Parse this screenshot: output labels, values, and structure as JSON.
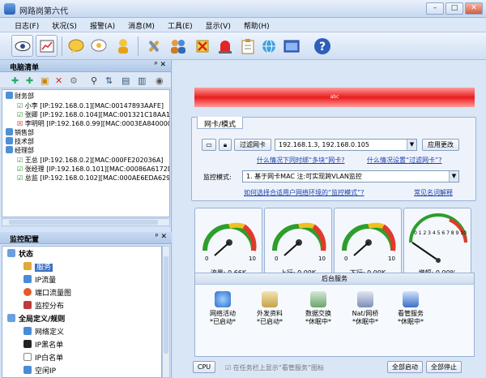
{
  "window": {
    "title": "网路岗第六代"
  },
  "menu": [
    "日志(F)",
    "状况(S)",
    "报警(A)",
    "消息(M)",
    "工具(E)",
    "显示(V)",
    "帮助(H)"
  ],
  "left_panel": {
    "title": "电脑清单",
    "tree": [
      {
        "label": "财务部",
        "kind": "group"
      },
      {
        "label": "小李 [IP:192.168.0.1][MAC:00147893AAFE]",
        "kind": "pc",
        "status": "ok"
      },
      {
        "label": "张卿 [IP:192.168.0.104][MAC:001321C18AA1]",
        "kind": "pc",
        "status": "ok"
      },
      {
        "label": "李明明 [IP:192.168.0.99][MAC:0003EA840000",
        "kind": "pc",
        "status": "no"
      },
      {
        "label": "销售部",
        "kind": "group"
      },
      {
        "label": "技术部",
        "kind": "group"
      },
      {
        "label": "经理部",
        "kind": "group"
      },
      {
        "label": "王总 [IP:192.168.0.2][MAC:000FE202036A]",
        "kind": "pc",
        "status": "ok"
      },
      {
        "label": "张经理 [IP:192.168.0.101][MAC:00086A6172D",
        "kind": "pc",
        "status": "ok"
      },
      {
        "label": "总监 [IP:192.168.0.102][MAC:000AE6EDA629]",
        "kind": "pc",
        "status": "ok"
      }
    ]
  },
  "config_panel": {
    "title": "监控配置",
    "items": [
      {
        "label": "状态",
        "level": 0
      },
      {
        "label": "服务",
        "level": 1,
        "selected": true
      },
      {
        "label": "IP流量",
        "level": 1
      },
      {
        "label": "端口流量图",
        "level": 1
      },
      {
        "label": "监控分布",
        "level": 1
      },
      {
        "label": "全局定义/规则",
        "level": 0
      },
      {
        "label": "网络定义",
        "level": 1
      },
      {
        "label": "IP黑名单",
        "level": 1
      },
      {
        "label": "IP白名单",
        "level": 1
      },
      {
        "label": "空闲IP",
        "level": 1
      }
    ]
  },
  "main": {
    "banner_text": "abc",
    "card": {
      "tab": "网卡/模式",
      "filter_button": "过滤网卡",
      "nic_value": "192.168.1.3, 192.168.0.105",
      "apply_button": "应用更改",
      "link_multi": "什么情况下同时绑“多块”网卡?",
      "link_filter": "什么情况设置“过滤网卡”?",
      "mode_label": "监控模式:",
      "mode_value": "1. 基于网卡MAC  注:可实现跨VLAN监控",
      "link_mode": "如何选择合适用户网络环境的“监控模式”?",
      "link_faq": "常见名词解释"
    },
    "gauges": [
      {
        "label": "流量: 0.66K",
        "value": 0.066,
        "max": 10,
        "type": "rainbow"
      },
      {
        "label": "上行: 0.00K",
        "value": 0.0,
        "max": 10,
        "type": "rainbow"
      },
      {
        "label": "下行: 0.00K",
        "value": 0.0,
        "max": 10,
        "type": "rainbow"
      },
      {
        "label": "增幅: 0.00%",
        "value": 0.0,
        "max": 10,
        "type": "arc"
      }
    ],
    "services": {
      "title": "后台服务",
      "items": [
        {
          "name": "网络活动",
          "status": "*已启动*"
        },
        {
          "name": "外发资料",
          "status": "*已启动*"
        },
        {
          "name": "数据交换",
          "status": "*休眠中*"
        },
        {
          "name": "Nat/网桥",
          "status": "*休眠中*"
        },
        {
          "name": "看管服务",
          "status": "*休眠中*"
        }
      ]
    },
    "bottom": {
      "cpu_button": "CPU",
      "tray_checkbox": "在任务栏上显示“看管服务”图标",
      "start_all": "全部启动",
      "stop_all": "全部停止"
    }
  }
}
